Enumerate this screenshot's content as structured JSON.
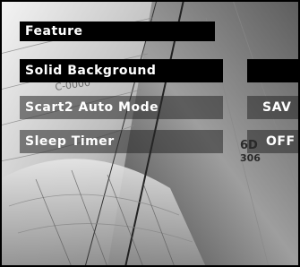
{
  "menu": {
    "title": "Feature",
    "items": [
      {
        "label": "Solid Background",
        "value": ""
      },
      {
        "label": "Scart2 Auto Mode",
        "value": "SAV"
      },
      {
        "label": "Sleep Timer",
        "value": "OFF"
      }
    ]
  },
  "background": {
    "sail_number_1": "6D",
    "sail_number_2": "306",
    "sail_number_3": "C-0000"
  },
  "colors": {
    "menu_background": "#000000",
    "menu_text": "#ffffff",
    "translucent_row": "#282828"
  }
}
